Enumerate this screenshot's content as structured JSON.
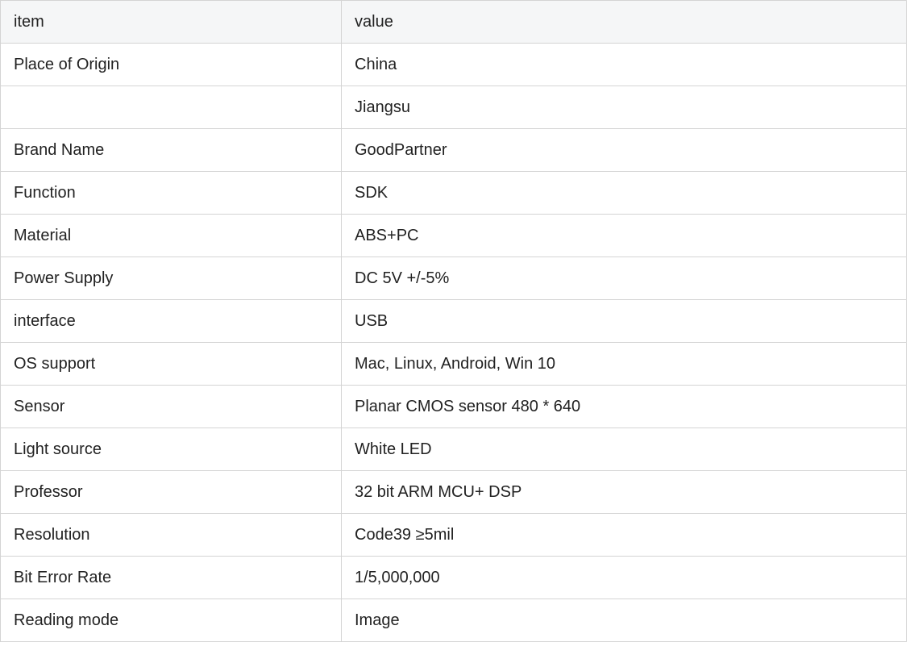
{
  "table": {
    "headers": [
      "item",
      "value"
    ],
    "rows": [
      [
        "Place of Origin",
        "China"
      ],
      [
        "",
        "Jiangsu"
      ],
      [
        "Brand Name",
        "GoodPartner"
      ],
      [
        "Function",
        "SDK"
      ],
      [
        "Material",
        "ABS+PC"
      ],
      [
        "Power Supply",
        "DC 5V +/-5%"
      ],
      [
        "interface",
        "USB"
      ],
      [
        "OS support",
        "Mac, Linux, Android, Win 10"
      ],
      [
        "Sensor",
        "Planar CMOS sensor 480 * 640"
      ],
      [
        "Light source",
        "White LED"
      ],
      [
        "Professor",
        "32 bit ARM MCU+ DSP"
      ],
      [
        "Resolution",
        "Code39 ≥5mil"
      ],
      [
        "Bit Error Rate",
        "1/5,000,000"
      ],
      [
        "Reading mode",
        "Image"
      ]
    ]
  },
  "colors": {
    "header_background": "#f5f6f7",
    "border": "#d4d4d4",
    "text": "#222222"
  }
}
